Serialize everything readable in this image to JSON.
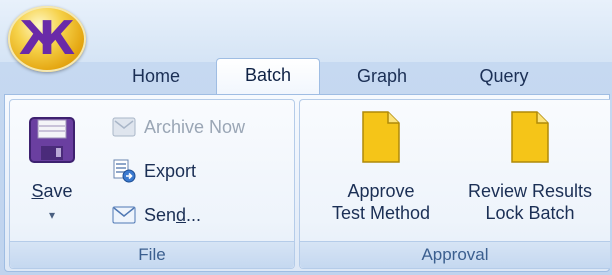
{
  "app": {
    "orb_glyph": "Ж"
  },
  "tabs": [
    {
      "label": "Home"
    },
    {
      "label": "Batch"
    },
    {
      "label": "Graph"
    },
    {
      "label": "Query"
    }
  ],
  "active_tab": "Batch",
  "groups": {
    "file": {
      "label": "File",
      "save": {
        "label": "Save",
        "mnemonic": "S",
        "rest": "ave",
        "dropdown": "▾"
      },
      "archive": {
        "label": "Archive Now",
        "enabled": false
      },
      "export": {
        "label": "Export"
      },
      "send": {
        "label_prefix": "Sen",
        "mnemonic": "d",
        "label_suffix": "..."
      }
    },
    "approval": {
      "label": "Approval",
      "approve": {
        "line1": "Approve",
        "line2": "Test Method"
      },
      "review": {
        "line1": "Review Results",
        "line2": "Lock Batch"
      }
    }
  },
  "colors": {
    "ribbon_bg": "#dde8f6",
    "tab_text": "#1b2f55",
    "group_label": "#3b5f8f",
    "doc_icon": "#f5c518",
    "save_icon": "#6a3fa0",
    "orb": "#e4a510"
  }
}
